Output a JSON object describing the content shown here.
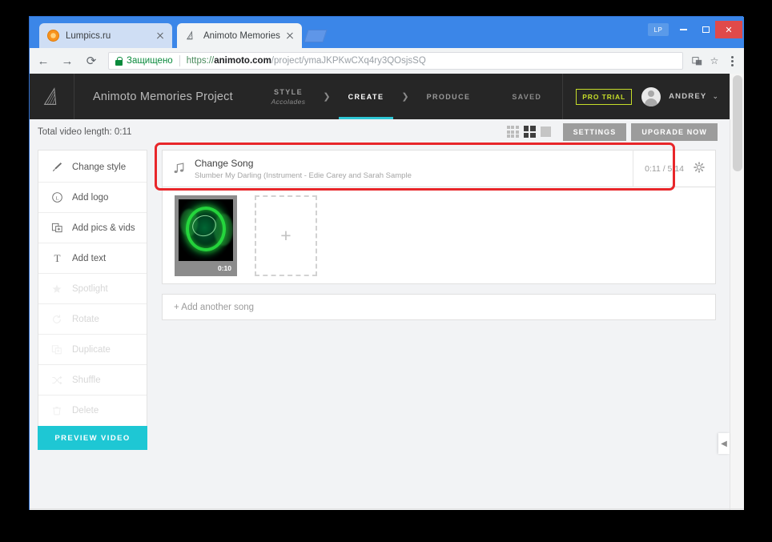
{
  "browser": {
    "tabs": [
      {
        "title": "Lumpics.ru",
        "favicon": "orange-circle-icon",
        "active": false
      },
      {
        "title": "Animoto Memories",
        "favicon": "animoto-logo-icon",
        "active": true
      }
    ],
    "nav": {
      "back": "←",
      "forward": "→",
      "reload": "⟳"
    },
    "security_label": "Защищено",
    "url": {
      "scheme": "https://",
      "domain": "animoto.com",
      "path": "/project/ymaJKPKwCXq4ry3QOsjsSQ",
      "full": "https://animoto.com/project/ymaJKPKwCXq4ry3QOsjsSQ"
    },
    "window_buttons": {
      "badge": "LP",
      "minimize": "–",
      "maximize": "☐",
      "close": "✕"
    }
  },
  "header": {
    "project_title": "Animoto Memories Project",
    "steps": [
      {
        "label": "STYLE",
        "sub": "Accolades",
        "current": false
      },
      {
        "label": "CREATE",
        "sub": "",
        "current": true
      },
      {
        "label": "PRODUCE",
        "sub": "",
        "current": false
      }
    ],
    "chevron": "❯",
    "saved_status": "SAVED",
    "pro_trial": "PRO TRIAL",
    "user_name": "ANDREY",
    "user_caret": "⌄"
  },
  "toolbar": {
    "total_length": "Total video length: 0:11",
    "settings_label": "SETTINGS",
    "upgrade_label": "UPGRADE NOW",
    "view_modes": [
      "grid-small-icon",
      "grid-medium-icon",
      "grid-single-icon"
    ]
  },
  "sidebar": {
    "items": [
      {
        "label": "Change style",
        "icon": "brush-icon",
        "glyph": "✐",
        "disabled": false
      },
      {
        "label": "Add logo",
        "icon": "logo-circle-icon",
        "glyph": "Ⓛ",
        "disabled": false
      },
      {
        "label": "Add pics & vids",
        "icon": "add-media-icon",
        "glyph": "⧉",
        "disabled": false
      },
      {
        "label": "Add text",
        "icon": "text-icon",
        "glyph": "T",
        "disabled": false
      },
      {
        "label": "Spotlight",
        "icon": "star-icon",
        "glyph": "★",
        "disabled": true
      },
      {
        "label": "Rotate",
        "icon": "rotate-icon",
        "glyph": "↻",
        "disabled": true
      },
      {
        "label": "Duplicate",
        "icon": "duplicate-icon",
        "glyph": "⧉",
        "disabled": true
      },
      {
        "label": "Shuffle",
        "icon": "shuffle-icon",
        "glyph": "⤨",
        "disabled": true
      },
      {
        "label": "Delete",
        "icon": "trash-icon",
        "glyph": "Ὕ1",
        "disabled": true
      }
    ],
    "preview_button": "PREVIEW VIDEO"
  },
  "main": {
    "song": {
      "title": "Change Song",
      "subtitle": "Slumber My Darling (Instrument - Edie Carey and Sarah Sample",
      "time": "0:11 / 5:14",
      "note_icon": "music-note-icon",
      "gear_icon": "gear-icon"
    },
    "thumbnail": {
      "duration": "0:10",
      "alt": "green-ring-video-thumbnail"
    },
    "add_tile_glyph": "+",
    "add_song_label": "+ Add another song"
  },
  "misc": {
    "collapse_arrow": "◀",
    "accent_color": "#1ec7d4",
    "highlight_color": "#e8262a",
    "pro_color": "#c6dd2a",
    "header_bg": "#262626"
  }
}
